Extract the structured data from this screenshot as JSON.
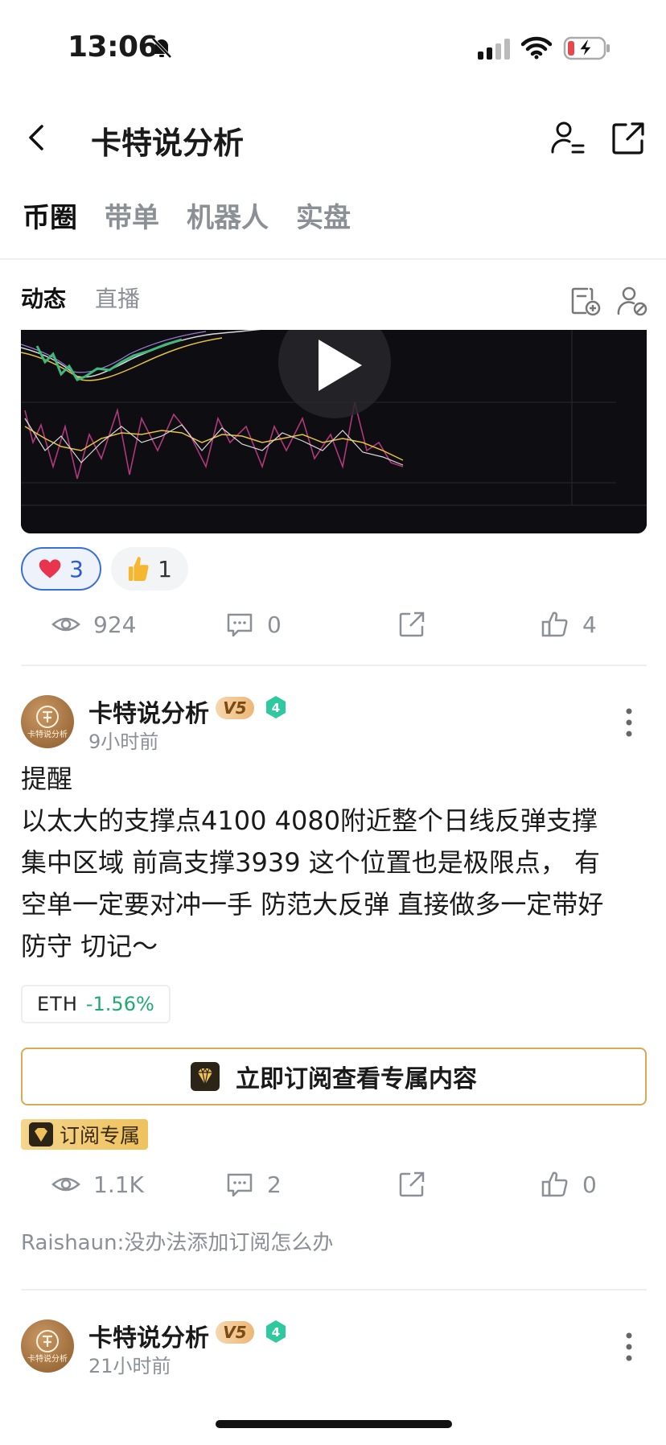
{
  "status_bar": {
    "time": "13:06"
  },
  "header": {
    "title": "卡特说分析"
  },
  "main_tabs": [
    {
      "label": "币圈"
    },
    {
      "label": "带单"
    },
    {
      "label": "机器人"
    },
    {
      "label": "实盘"
    }
  ],
  "sub_tabs": [
    {
      "label": "动态"
    },
    {
      "label": "直播"
    }
  ],
  "post1": {
    "reactions": [
      {
        "emoji": "heart-icon",
        "count": "3"
      },
      {
        "emoji": "thumbs-up-emoji-icon",
        "count": "1"
      }
    ],
    "stats": {
      "views": "924",
      "comments": "0",
      "likes": "4"
    }
  },
  "post2": {
    "author": "卡特说分析",
    "vip": "V5",
    "level": "4",
    "time": "9小时前",
    "body": [
      "提醒",
      "以太大的支撑点4100 4080附近整个日线反弹支撑",
      "集中区域  前高支撑3939  这个位置也是极限点， 有",
      "空单一定要对冲一手 防范大反弹  直接做多一定带好",
      "防守 切记～"
    ],
    "ticker": {
      "symbol": "ETH",
      "change": "-1.56%"
    },
    "subscribe_label": "立即订阅查看专属内容",
    "exclusive_tag": "订阅专属",
    "stats": {
      "views": "1.1K",
      "comments": "2",
      "likes": "0"
    },
    "comment_preview": "Raishaun:没办法添加订阅怎么办"
  },
  "post3": {
    "author": "卡特说分析",
    "vip": "V5",
    "level": "4",
    "time": "21小时前"
  },
  "avatar_text": "卡特说分析",
  "colors": {
    "accent": "#3b6fd8",
    "gold": "#d7aa56",
    "up": "#1fa971"
  }
}
